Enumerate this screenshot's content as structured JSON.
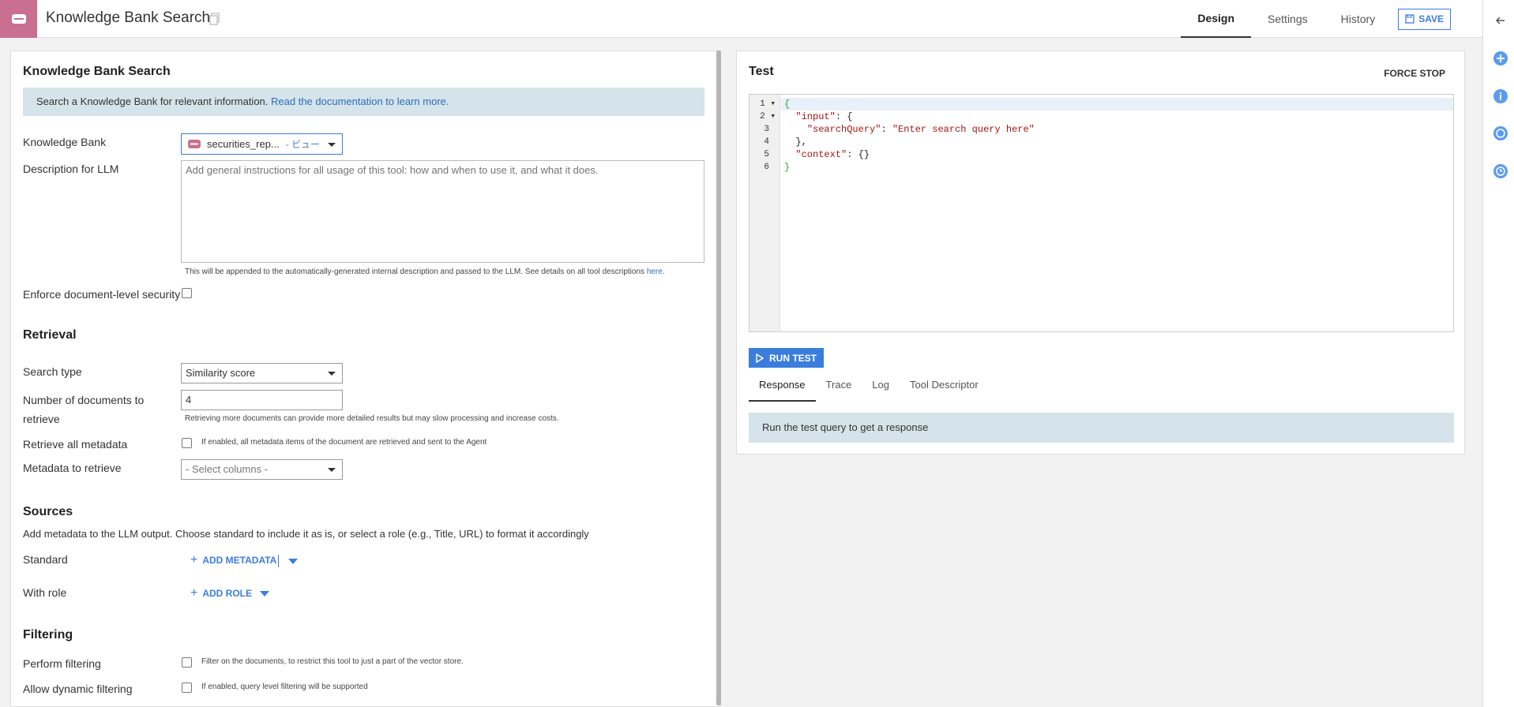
{
  "header": {
    "title": "Knowledge Bank Search",
    "tabs": [
      {
        "label": "Design",
        "active": true
      },
      {
        "label": "Settings",
        "active": false
      },
      {
        "label": "History",
        "active": false
      }
    ],
    "save_label": "SAVE"
  },
  "colors": {
    "accent": "#3b7ddd",
    "brand": "#c97090",
    "info_bg": "#d5e3ea"
  },
  "form": {
    "title": "Knowledge Bank Search",
    "info_text": "Search a Knowledge Bank for relevant information.",
    "info_link": "Read the documentation to learn more.",
    "knowledge_bank_label": "Knowledge Bank",
    "knowledge_bank_value": "securities_rep...",
    "knowledge_bank_tag": "- ビュー",
    "description_label": "Description for LLM",
    "description_placeholder": "Add general instructions for all usage of this tool: how and when to use it, and what it does.",
    "description_help": "This will be appended to the automatically-generated internal description and passed to the LLM. See details on all tool descriptions",
    "description_help_link": "here",
    "enforce_label": "Enforce document-level security",
    "retrieval_section": "Retrieval",
    "search_type_label": "Search type",
    "search_type_value": "Similarity score",
    "num_docs_label": "Number of documents to retrieve",
    "num_docs_value": "4",
    "num_docs_help": "Retrieving more documents can provide more detailed results but may slow processing and increase costs.",
    "retrieve_all_label": "Retrieve all metadata",
    "retrieve_all_help": "If enabled, all metadata items of the document are retrieved and sent to the Agent",
    "metadata_label": "Metadata to retrieve",
    "metadata_placeholder": "- Select columns -",
    "sources_section": "Sources",
    "sources_help": "Add metadata to the LLM output. Choose standard to include it as is, or select a role (e.g., Title, URL) to format it accordingly",
    "standard_label": "Standard",
    "add_metadata_label": "ADD METADATA",
    "with_role_label": "With role",
    "add_role_label": "ADD ROLE",
    "filtering_section": "Filtering",
    "perform_filtering_label": "Perform filtering",
    "perform_filtering_help": "Filter on the documents, to restrict this tool to just a part of the vector store.",
    "dynamic_filtering_label": "Allow dynamic filtering",
    "dynamic_filtering_help": "If enabled, query level filtering will be supported"
  },
  "test": {
    "title": "Test",
    "force_stop_label": "FORCE STOP",
    "line_numbers": [
      "1",
      "2",
      "3",
      "4",
      "5",
      "6"
    ],
    "code": {
      "l1": "{",
      "l2_key": "\"input\"",
      "l2_rest": ": {",
      "l3_key": "\"searchQuery\"",
      "l3_sep": ": ",
      "l3_val": "\"Enter search query here\"",
      "l4": "},",
      "l5_key": "\"context\"",
      "l5_rest": ": {}",
      "l6": "}"
    },
    "run_label": "RUN TEST",
    "tabs": [
      {
        "label": "Response",
        "active": true
      },
      {
        "label": "Trace",
        "active": false
      },
      {
        "label": "Log",
        "active": false
      },
      {
        "label": "Tool Descriptor",
        "active": false
      }
    ],
    "response_text": "Run the test query to get a response"
  },
  "rail_icons": [
    "back-arrow-icon",
    "add-icon",
    "info-icon",
    "chat-icon",
    "history-icon"
  ]
}
